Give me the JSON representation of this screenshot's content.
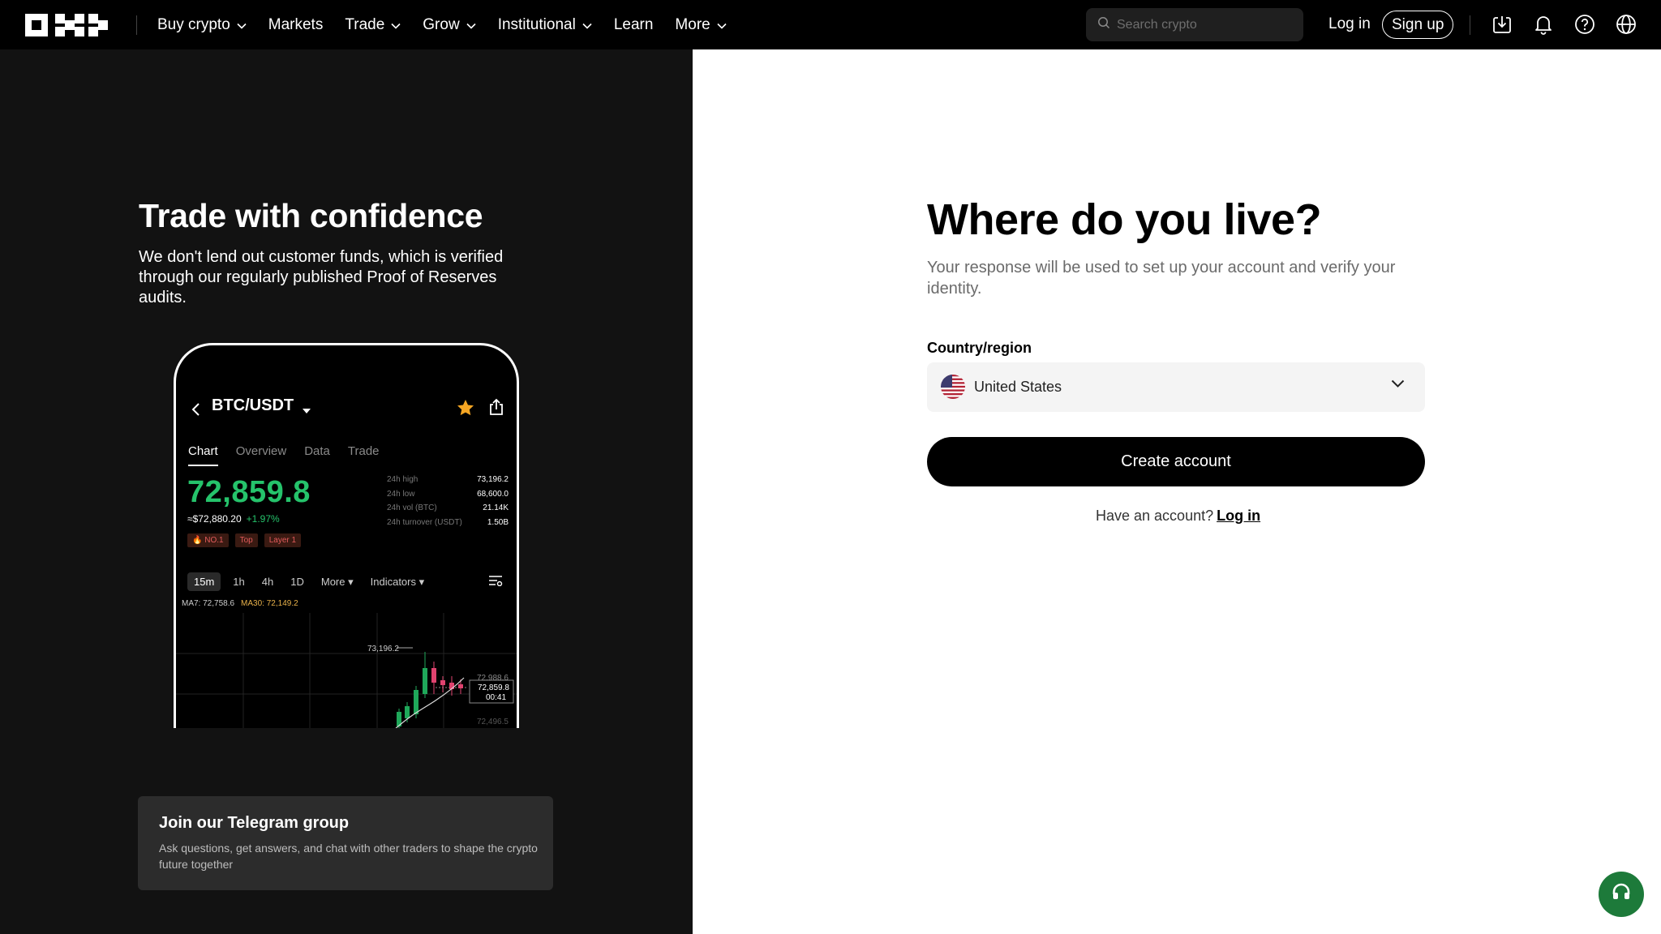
{
  "nav": {
    "menu": [
      {
        "label": "Buy crypto",
        "has_dropdown": true
      },
      {
        "label": "Markets",
        "has_dropdown": false
      },
      {
        "label": "Trade",
        "has_dropdown": true
      },
      {
        "label": "Grow",
        "has_dropdown": true
      },
      {
        "label": "Institutional",
        "has_dropdown": true
      },
      {
        "label": "Learn",
        "has_dropdown": false
      },
      {
        "label": "More",
        "has_dropdown": true
      }
    ],
    "search_placeholder": "Search crypto",
    "login_label": "Log in",
    "signup_label": "Sign up",
    "icons": [
      "download-icon",
      "bell-icon",
      "help-icon",
      "globe-icon"
    ]
  },
  "left": {
    "title": "Trade with confidence",
    "description": "We don't lend out customer funds, which is verified through our regularly published Proof of Reserves audits.",
    "phone": {
      "pair": "BTC/USDT",
      "tabs": [
        "Chart",
        "Overview",
        "Data",
        "Trade"
      ],
      "active_tab": "Chart",
      "price": "72,859.8",
      "fiat_price": "≈$72,880.20",
      "change": "+1.97%",
      "tags": [
        "NO.1",
        "Top",
        "Layer 1"
      ],
      "stats": [
        {
          "k": "24h high",
          "v": "73,196.2"
        },
        {
          "k": "24h low",
          "v": "68,600.0"
        },
        {
          "k": "24h vol (BTC)",
          "v": "21.14K"
        },
        {
          "k": "24h turnover (USDT)",
          "v": "1.50B"
        }
      ],
      "intervals": [
        "15m",
        "1h",
        "4h",
        "1D",
        "More",
        "Indicators"
      ],
      "active_interval": "15m",
      "ma7": "MA7: 72,758.6",
      "ma30": "MA30: 72,149.2",
      "chart_labels": {
        "peak": "73,196.2",
        "level_1": "72,988.6",
        "current": "72,859.8",
        "countdown": "00:41",
        "level_2": "72,496.5"
      }
    },
    "telegram": {
      "title": "Join our Telegram group",
      "description": "Ask questions, get answers, and chat with other traders to shape the crypto future together"
    }
  },
  "right": {
    "title": "Where do you live?",
    "description": "Your response will be used to set up your account and verify your identity.",
    "field_label": "Country/region",
    "selected_country": "United States",
    "create_label": "Create account",
    "have_account": "Have an account?",
    "login_link": "Log in"
  },
  "colors": {
    "nav_bg": "#000000",
    "left_bg": "#121212",
    "price_green": "#25c36b",
    "support_green": "#1d7a3a",
    "card_bg": "#2c2c2c"
  }
}
